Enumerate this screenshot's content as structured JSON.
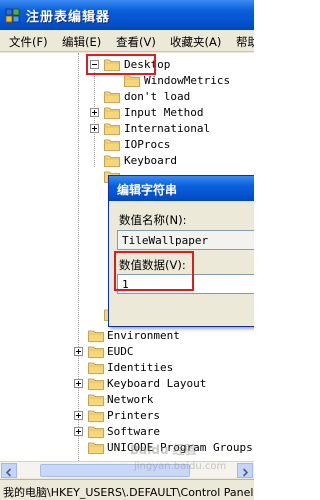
{
  "window": {
    "title": "注册表编辑器"
  },
  "menu": [
    "文件(F)",
    "编辑(E)",
    "查看(V)",
    "收藏夹(A)",
    "帮助"
  ],
  "tree": {
    "nodes": [
      {
        "label": "Desktop",
        "expander": "minus"
      },
      {
        "label": "WindowMetrics",
        "expander": "none"
      },
      {
        "label": "don't load",
        "expander": "none"
      },
      {
        "label": "Input Method",
        "expander": "plus"
      },
      {
        "label": "International",
        "expander": "plus"
      },
      {
        "label": "IOProcs",
        "expander": "none"
      },
      {
        "label": "Keyboard",
        "expander": "none"
      },
      {
        "label": "Environment",
        "expander": "none"
      },
      {
        "label": "EUDC",
        "expander": "plus"
      },
      {
        "label": "Identities",
        "expander": "none"
      },
      {
        "label": "Keyboard Layout",
        "expander": "plus"
      },
      {
        "label": "Network",
        "expander": "none"
      },
      {
        "label": "Printers",
        "expander": "plus"
      },
      {
        "label": "Software",
        "expander": "plus"
      },
      {
        "label": "UNICODE Program Groups",
        "expander": "none"
      }
    ]
  },
  "dialog": {
    "title": "编辑字符串",
    "value_name_label": "数值名称(N):",
    "value_name": "TileWallpaper",
    "value_data_label": "数值数据(V):",
    "value_data": "1"
  },
  "status_bar": {
    "path": "我的电脑\\HKEY_USERS\\.DEFAULT\\Control Panel"
  },
  "watermark": {
    "text": "Baidu 经验",
    "url_text": "jingyan.baidu.com"
  },
  "colors": {
    "highlight": "#d42020",
    "titlebar": "#0a5fdc",
    "dialog_border": "#0831a8"
  },
  "icons": [
    "regedit-icon",
    "folder-icon",
    "expand-icon",
    "collapse-icon",
    "scroll-left-icon",
    "scroll-right-icon"
  ]
}
